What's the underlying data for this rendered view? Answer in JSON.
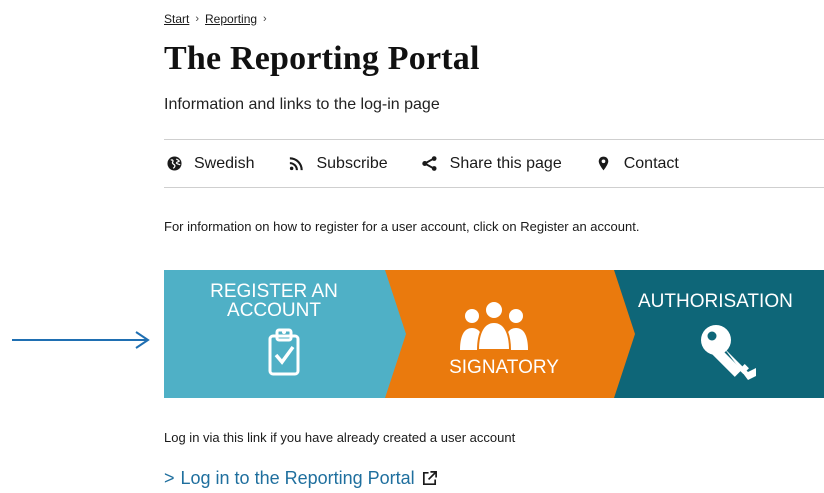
{
  "breadcrumb": {
    "items": [
      "Start",
      "Reporting"
    ],
    "separator": "›"
  },
  "page": {
    "title": "The Reporting Portal",
    "subtitle": "Information and links to the log-in page"
  },
  "toolbar": {
    "items": [
      {
        "label": "Swedish",
        "icon": "globe-icon"
      },
      {
        "label": "Subscribe",
        "icon": "rss-icon"
      },
      {
        "label": "Share this page",
        "icon": "share-icon"
      },
      {
        "label": "Contact",
        "icon": "map-marker-icon"
      }
    ]
  },
  "intro_text": "For information on how to register for a user account, click on Register an account.",
  "banner": {
    "register": {
      "line1": "REGISTER AN",
      "line2": "ACCOUNT",
      "icon": "clipboard-check-icon",
      "color": "#4fb0c6"
    },
    "signatory": {
      "label": "SIGNATORY",
      "icon": "users-icon",
      "color": "#ea7a0d"
    },
    "authorisation": {
      "label": "AUTHORISATION",
      "icon": "key-icon",
      "color": "#0e6678"
    }
  },
  "indicator_arrow_color": "#1f6fb2",
  "login": {
    "text": "Log in via this link if you have already created a user account",
    "chevron": ">",
    "link_label": "Log in to the Reporting Portal",
    "link_color": "#1f6f9e"
  }
}
